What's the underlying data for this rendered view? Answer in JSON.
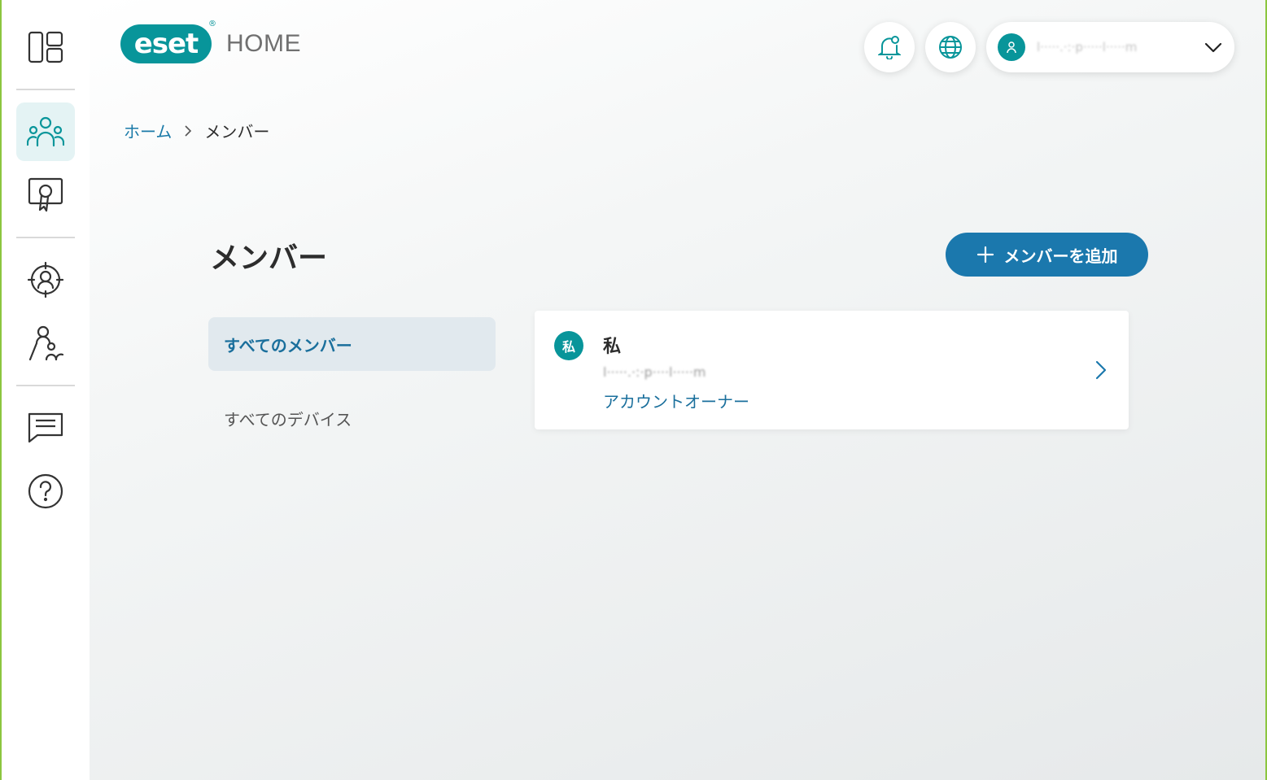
{
  "app": {
    "brand": "eset",
    "brand_reg": "®",
    "product": "HOME"
  },
  "sidebar": {
    "items": [
      {
        "name": "dashboard",
        "icon": "dashboard-icon"
      },
      {
        "name": "members",
        "icon": "people-icon",
        "active": true
      },
      {
        "name": "licenses",
        "icon": "license-icon"
      },
      {
        "name": "anti-theft",
        "icon": "anti-theft-icon"
      },
      {
        "name": "parental-control",
        "icon": "family-icon"
      },
      {
        "name": "feedback",
        "icon": "chat-icon"
      },
      {
        "name": "help",
        "icon": "help-icon"
      }
    ]
  },
  "header": {
    "notifications_icon": "bell-icon",
    "language_icon": "globe-icon",
    "account": {
      "email": "l·····.·:·p·····l·····m",
      "avatar_icon": "user-icon",
      "dropdown_icon": "chevron-down-icon"
    }
  },
  "breadcrumb": {
    "home": "ホーム",
    "current": "メンバー"
  },
  "page": {
    "title": "メンバー",
    "add_button": "メンバーを追加"
  },
  "nav": {
    "all_members": "すべてのメンバー",
    "all_devices": "すべてのデバイス"
  },
  "members": [
    {
      "avatar": "私",
      "name": "私",
      "email": "l·····.·:·p····l·····m",
      "role": "アカウントオーナー"
    }
  ],
  "colors": {
    "teal": "#08959a",
    "primary_blue": "#1b78ad",
    "link_blue": "#1a7aa8",
    "frame_green": "#8cc63f"
  }
}
